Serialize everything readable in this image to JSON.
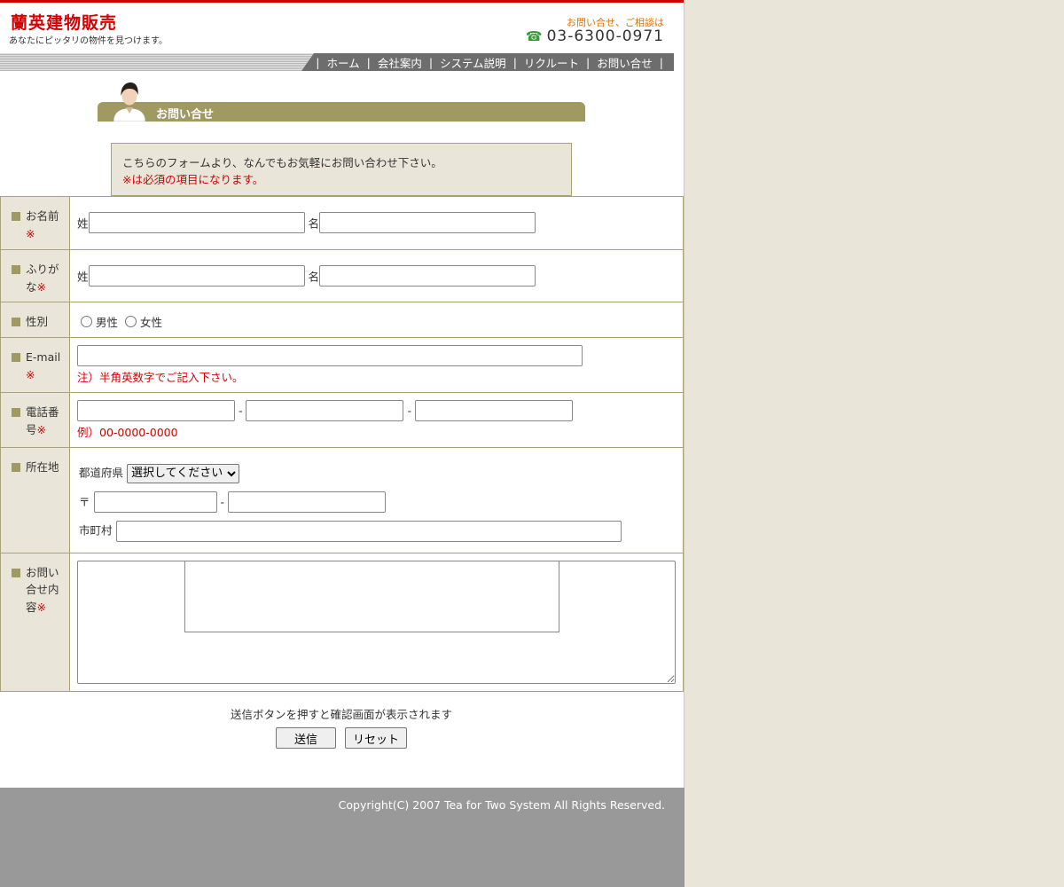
{
  "header": {
    "logo": "蘭英建物販売",
    "tagline": "あなたにピッタリの物件を見つけます。",
    "contact_label": "お問い合せ、ご相談は",
    "phone": "03-6300-0971"
  },
  "nav": {
    "items": [
      "ホーム",
      "会社案内",
      "システム説明",
      "リクルート",
      "お問い合せ"
    ],
    "separator": "|"
  },
  "page_title": "お問い合せ",
  "intro": {
    "line1": "こちらのフォームより、なんでもお気軽にお問い合わせ下さい。",
    "line2": "※は必須の項目になります。"
  },
  "form": {
    "required_mark": "※",
    "name": {
      "label": "お名前",
      "last": "姓",
      "first": "名"
    },
    "kana": {
      "label": "ふりがな",
      "last": "姓",
      "first": "名"
    },
    "gender": {
      "label": "性別",
      "male": "男性",
      "female": "女性"
    },
    "email": {
      "label": "E-mail",
      "note": "注）半角英数字でご記入下さい。"
    },
    "phone": {
      "label": "電話番号",
      "dash": "-",
      "note": "例）00-0000-0000"
    },
    "address": {
      "label": "所在地",
      "prefecture_label": "都道府県",
      "prefecture_selected": "選択してください",
      "postal_mark": "〒",
      "dash": "-",
      "city_label": "市町村"
    },
    "inquiry": {
      "label": "お問い合せ内容"
    }
  },
  "submit": {
    "note": "送信ボタンを押すと確認画面が表示されます",
    "send_label": "送信",
    "reset_label": "リセット"
  },
  "footer": {
    "copyright": "Copyright(C) 2007 Tea for Two System All Rights Reserved."
  },
  "colors": {
    "accent_red": "#d40000",
    "olive": "#a09a62",
    "beige": "#e9e6d9",
    "footer_gray": "#999999"
  }
}
